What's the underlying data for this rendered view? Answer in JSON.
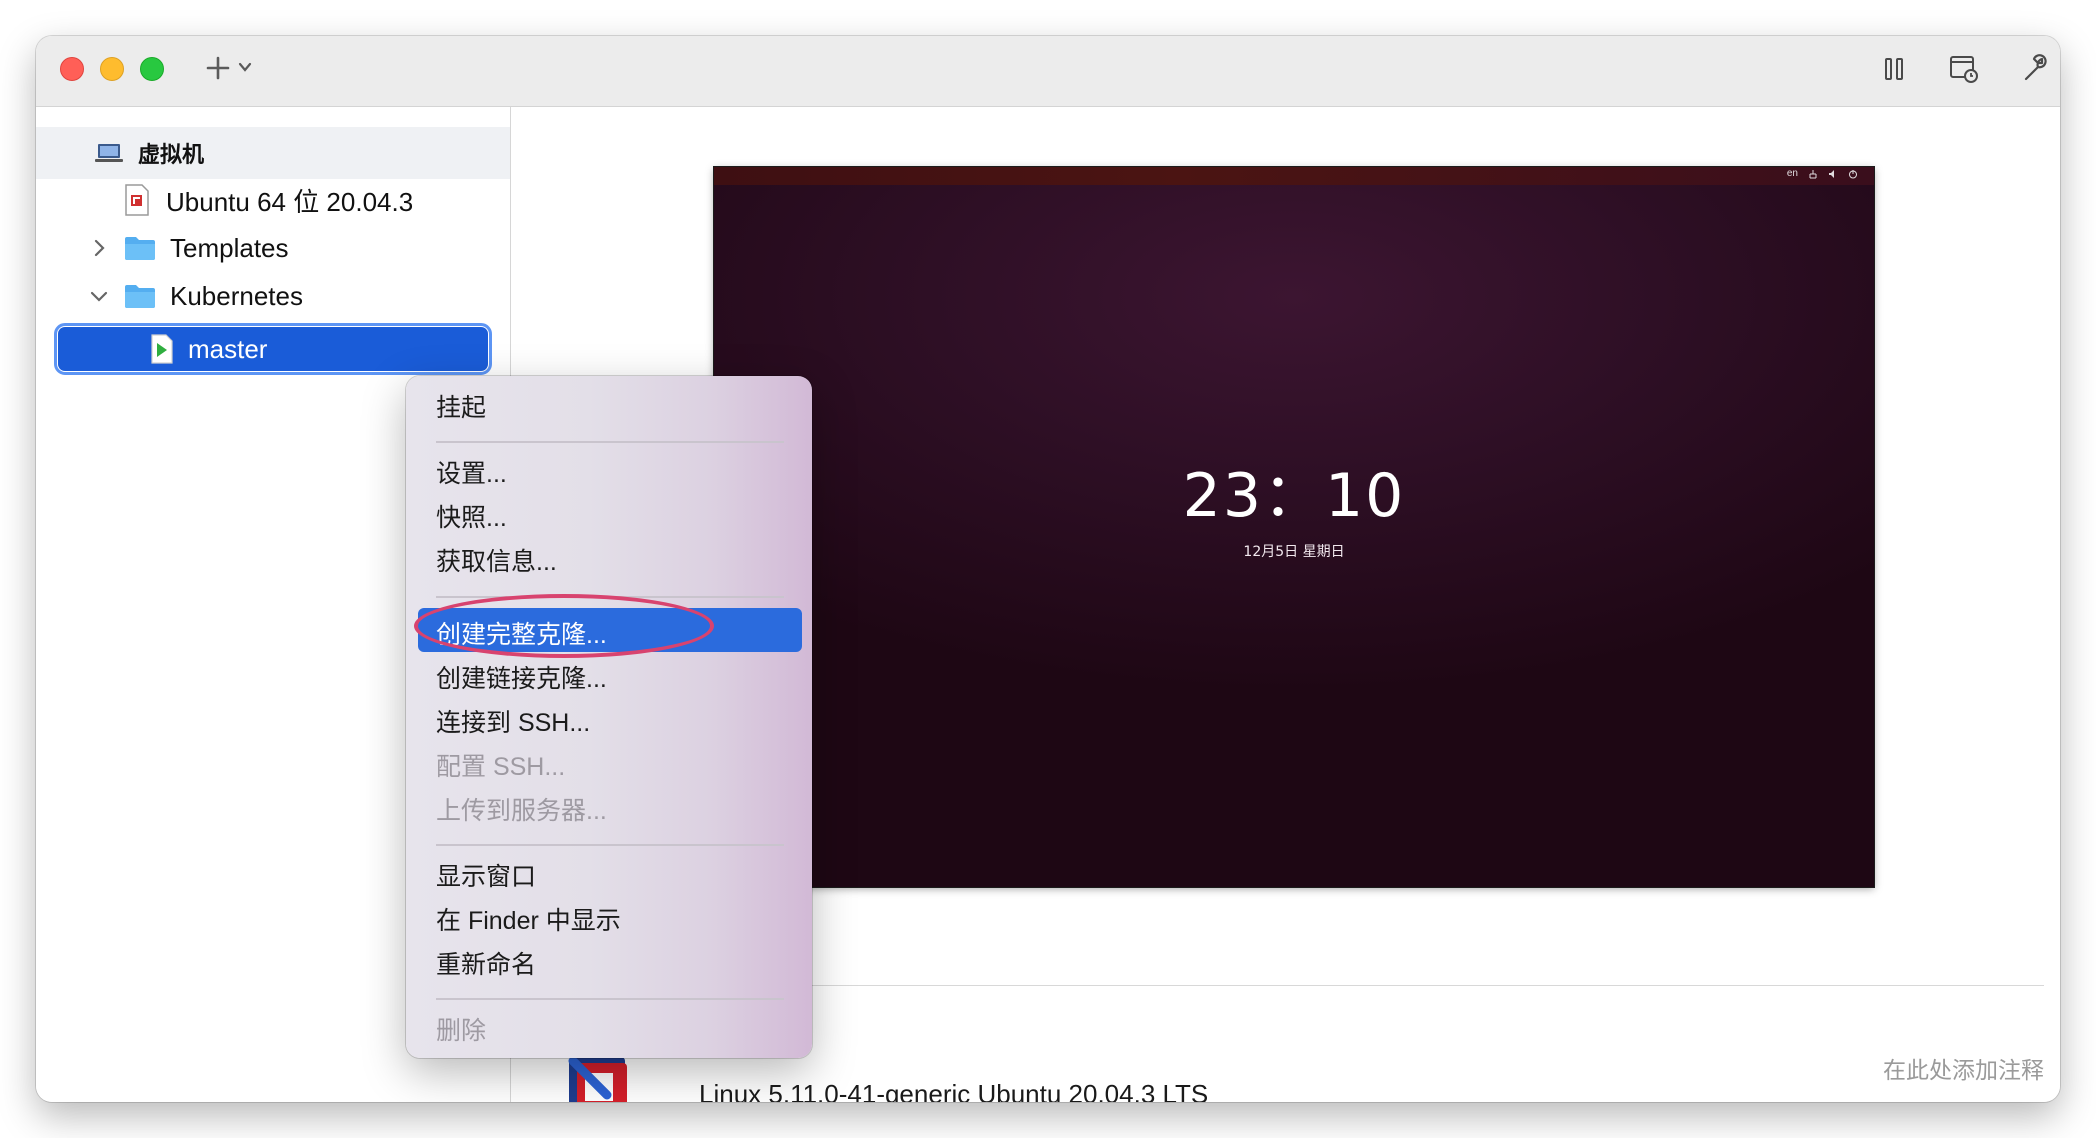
{
  "toolbar": {
    "add_icon": "plus-icon",
    "add_menu_icon": "chevron-down-icon",
    "tools": [
      "pause-icon",
      "snapshot-icon",
      "wrench-icon"
    ]
  },
  "sidebar": {
    "header": "虚拟机",
    "items": [
      {
        "label": "Ubuntu 64 位 20.04.3",
        "icon": "vm-file-icon"
      },
      {
        "label": "Templates",
        "icon": "folder-icon",
        "expanded": false
      },
      {
        "label": "Kubernetes",
        "icon": "folder-icon",
        "expanded": true
      },
      {
        "label": "master",
        "icon": "vm-running-icon",
        "selected": true
      }
    ]
  },
  "preview": {
    "status_lang": "en",
    "clock": "23：10",
    "date": "12月5日 星期日"
  },
  "details": {
    "os": "Linux 5.11.0-41-generic Ubuntu 20.04.3 LTS",
    "notes_placeholder": "在此处添加注释"
  },
  "context_menu": {
    "suspend": "挂起",
    "settings": "设置...",
    "snapshots": "快照...",
    "get_info": "获取信息...",
    "full_clone": "创建完整克隆...",
    "linked_clone": "创建链接克隆...",
    "connect_ssh": "连接到 SSH...",
    "configure_ssh": "配置 SSH...",
    "upload_server": "上传到服务器...",
    "show_window": "显示窗口",
    "show_in_finder": "在 Finder 中显示",
    "rename": "重新命名",
    "delete": "删除"
  },
  "colors": {
    "selection": "#1a5cd8",
    "menu_highlight": "#2b6bdd",
    "annotation_circle": "#d8436f",
    "vm_background": "#2e0f25"
  }
}
